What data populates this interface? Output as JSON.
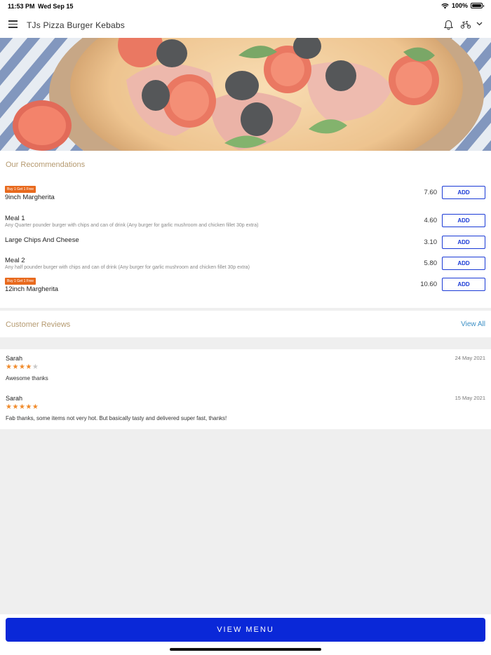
{
  "status_bar": {
    "time": "11:53 PM",
    "date": "Wed Sep 15",
    "battery": "100%"
  },
  "header": {
    "title": "TJs Pizza  Burger  Kebabs"
  },
  "recommendations": {
    "title": "Our Recommendations",
    "add_label": "ADD",
    "items": [
      {
        "badge": "Buy 1 Get 1 Free",
        "name": "9inch Margherita",
        "desc": "",
        "price": "7.60"
      },
      {
        "badge": "",
        "name": "Meal 1",
        "desc": "Any Quarter pounder burger with chips and can of drink (Any burger for garlic mushroom and chicken fillet 30p extra)",
        "price": "4.60"
      },
      {
        "badge": "",
        "name": "Large Chips And Cheese",
        "desc": "",
        "price": "3.10"
      },
      {
        "badge": "",
        "name": "Meal 2",
        "desc": "Any half pounder burger with chips and can of drink (Any burger for garlic mushroom and chicken fillet 30p extra)",
        "price": "5.80"
      },
      {
        "badge": "Buy 1 Get 1 Free",
        "name": "12inch Margherita",
        "desc": "",
        "price": "10.60"
      }
    ]
  },
  "reviews": {
    "title": "Customer Reviews",
    "view_all": "View All",
    "items": [
      {
        "name": "Sarah",
        "date": "24 May 2021",
        "rating": 4,
        "text": "Awesome thanks"
      },
      {
        "name": "Sarah",
        "date": "15 May 2021",
        "rating": 5,
        "text": "Fab thanks, some items not very hot. But basically tasty and delivered super fast, thanks!"
      }
    ]
  },
  "footer": {
    "view_menu": "VIEW MENU"
  },
  "colors": {
    "accent": "#0a28d8",
    "badge": "#e86a1e",
    "star": "#f08a2a",
    "section_title": "#b59a70",
    "link": "#3b8fc5"
  }
}
